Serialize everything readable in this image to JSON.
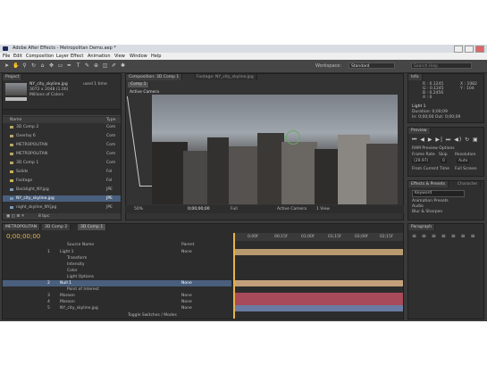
{
  "window": {
    "title": "Adobe After Effects - Metropolitan Demo.aep *"
  },
  "menu": [
    "File",
    "Edit",
    "Composition",
    "Layer",
    "Effect",
    "Animation",
    "View",
    "Window",
    "Help"
  ],
  "toolbar": {
    "workspace_label": "Workspace:",
    "workspace_value": "Standard",
    "search_placeholder": "Search Help"
  },
  "project": {
    "tab": "Project",
    "selected_item_name": "NY_city_skyline.jpg",
    "selected_item_info": "used 1 time",
    "selected_item_dims": "3072 x 2048 (1.00)",
    "selected_item_color": "Millions of Colors",
    "col_name": "Name",
    "col_type": "Type",
    "items": [
      {
        "name": "3D Comp 2",
        "type": "Com",
        "color": "#b8a46a"
      },
      {
        "name": "Overlay 6",
        "type": "Com",
        "color": "#b8a46a"
      },
      {
        "name": "METROPOLITAN",
        "type": "Com",
        "color": "#b8a46a"
      },
      {
        "name": "METROPOLITAN",
        "type": "Com",
        "color": "#b8a46a"
      },
      {
        "name": "3D Comp 1",
        "type": "Com",
        "color": "#b8a46a"
      },
      {
        "name": "Solids",
        "type": "Fol",
        "color": "#c9b15a"
      },
      {
        "name": "Footage",
        "type": "Fol",
        "color": "#c9b15a"
      },
      {
        "name": "Backlight_NY.jpg",
        "type": "JPE",
        "color": "#7a9ab8"
      },
      {
        "name": "NY_city_skyline.jpg",
        "type": "JPE",
        "color": "#7a9ab8"
      },
      {
        "name": "night_skyline_NY.jpg",
        "type": "JPE",
        "color": "#7a9ab8"
      }
    ],
    "footer": "8 bpc"
  },
  "composition": {
    "tab": "Composition: 3D Comp 1",
    "footage_tab": "Footage: NY_city_skyline.jpg",
    "subtab": "Comp 1",
    "camera_label": "Active Camera",
    "zoom": "50%",
    "timecode": "0;00;00;00",
    "view_label": "Full",
    "camera_view": "Active Camera",
    "views": "1 View"
  },
  "info": {
    "tab": "Info",
    "r": "R : 0.1245",
    "g": "G : 0.1245",
    "b": "B : 0.2456",
    "a": "A : 0",
    "x": "X : 1082",
    "y": "Y : 104",
    "layer_name": "Light 1",
    "duration": "Duration: 0;00;09",
    "in_out": "In: 0;00;00 Out: 0;00;09"
  },
  "preview": {
    "tab": "Preview",
    "ram_options": "RAM Preview Options",
    "frame_rate": "Frame Rate",
    "skip": "Skip",
    "resolution": "Resolution",
    "frame_rate_value": "(29.97)",
    "skip_value": "0",
    "resolution_value": "Auto",
    "from_current": "From Current Time",
    "full_screen": "Full Screen"
  },
  "effects": {
    "tab": "Effects & Presets",
    "character_tab": "Character",
    "dropdown": "Keyword",
    "animation_presets": "Animation Presets",
    "audio": "Audio",
    "blur": "Blur & Sharpen"
  },
  "timeline": {
    "tabs": [
      "METROPOLITAN",
      "3D Comp 2",
      "3D Comp 1"
    ],
    "timecode": "0;00;00;00",
    "col_source": "Source Name",
    "col_parent": "Parent",
    "ruler": [
      "0;00f",
      "00;15f",
      "01;00f",
      "01;15f",
      "02;00f",
      "02;15f"
    ],
    "layers": [
      {
        "num": "1",
        "name": "Light 1",
        "parent": "None",
        "color": "#b89a6e"
      },
      {
        "num": "",
        "name": "Transform",
        "parent": "",
        "color": ""
      },
      {
        "num": "",
        "name": "Intensity",
        "parent": "",
        "color": ""
      },
      {
        "num": "",
        "name": "Color",
        "parent": "",
        "color": ""
      },
      {
        "num": "",
        "name": "Light Options",
        "parent": "",
        "color": ""
      },
      {
        "num": "2",
        "name": "Null 1",
        "parent": "None",
        "color": "#c4a07a"
      },
      {
        "num": "",
        "name": "Point of Interest",
        "parent": "",
        "color": ""
      },
      {
        "num": "3",
        "name": "Maroon",
        "parent": "None",
        "color": "#a84a5a"
      },
      {
        "num": "4",
        "name": "Maroon",
        "parent": "None",
        "color": "#a84a5a"
      },
      {
        "num": "5",
        "name": "NY_city_skyline.jpg",
        "parent": "None",
        "color": "#6a7aa0"
      }
    ],
    "footer": "Toggle Switches / Modes"
  },
  "paragraph": {
    "tab": "Paragraph"
  }
}
